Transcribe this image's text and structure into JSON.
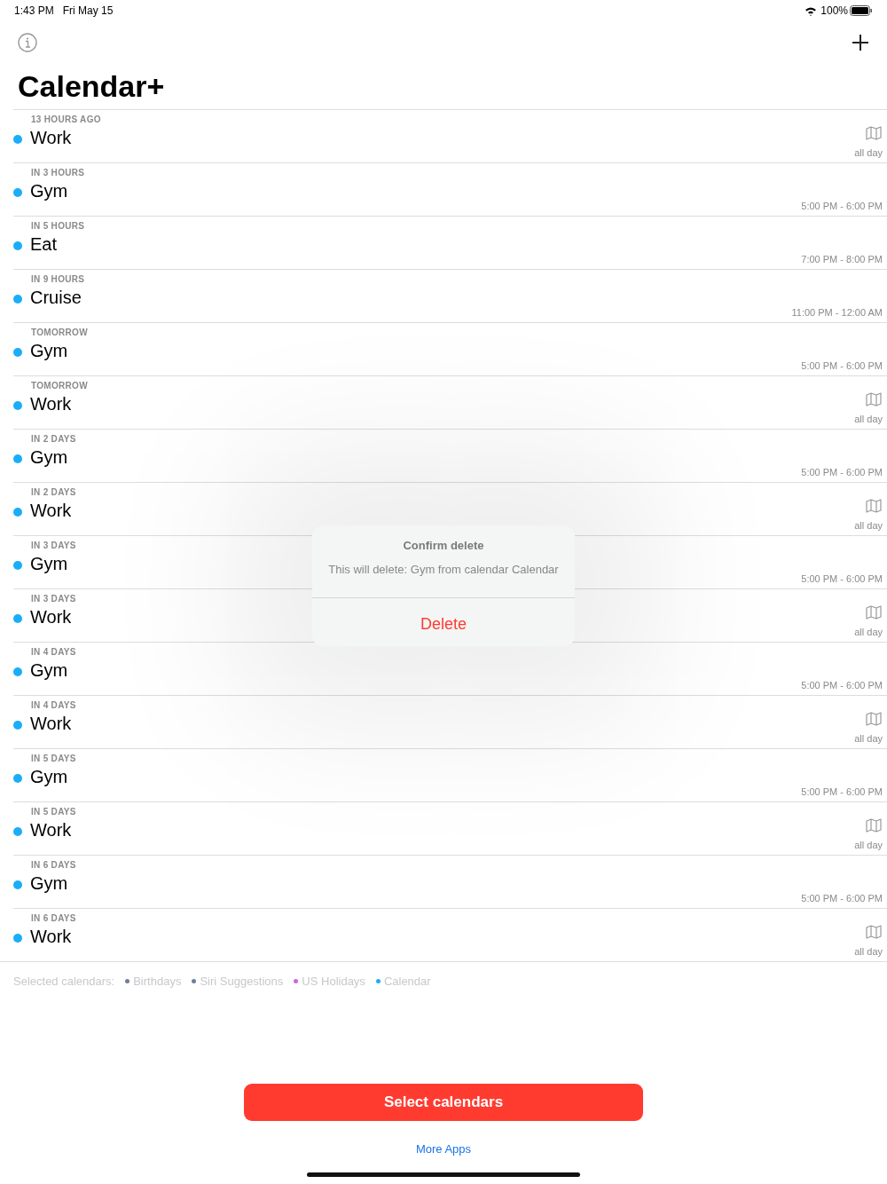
{
  "status_bar": {
    "time": "1:43 PM",
    "date": "Fri May 15",
    "battery": "100%"
  },
  "title": "Calendar+",
  "events": [
    {
      "when": "13 HOURS AGO",
      "title": "Work",
      "kind": "all_day",
      "time": "all day",
      "color": "#1badf8"
    },
    {
      "when": "IN 3 HOURS",
      "title": "Gym",
      "kind": "timed",
      "time": "5:00 PM - 6:00 PM",
      "color": "#1badf8"
    },
    {
      "when": "IN 5 HOURS",
      "title": "Eat",
      "kind": "timed",
      "time": "7:00 PM - 8:00 PM",
      "color": "#1badf8"
    },
    {
      "when": "IN 9 HOURS",
      "title": "Cruise",
      "kind": "timed",
      "time": "11:00 PM - 12:00 AM",
      "color": "#1badf8"
    },
    {
      "when": "TOMORROW",
      "title": "Gym",
      "kind": "timed",
      "time": "5:00 PM - 6:00 PM",
      "color": "#1badf8"
    },
    {
      "when": "TOMORROW",
      "title": "Work",
      "kind": "all_day",
      "time": "all day",
      "color": "#1badf8"
    },
    {
      "when": "IN 2 DAYS",
      "title": "Gym",
      "kind": "timed",
      "time": "5:00 PM - 6:00 PM",
      "color": "#1badf8"
    },
    {
      "when": "IN 2 DAYS",
      "title": "Work",
      "kind": "all_day",
      "time": "all day",
      "color": "#1badf8"
    },
    {
      "when": "IN 3 DAYS",
      "title": "Gym",
      "kind": "timed",
      "time": "5:00 PM - 6:00 PM",
      "color": "#1badf8"
    },
    {
      "when": "IN 3 DAYS",
      "title": "Work",
      "kind": "all_day",
      "time": "all day",
      "color": "#1badf8"
    },
    {
      "when": "IN 4 DAYS",
      "title": "Gym",
      "kind": "timed",
      "time": "5:00 PM - 6:00 PM",
      "color": "#1badf8"
    },
    {
      "when": "IN 4 DAYS",
      "title": "Work",
      "kind": "all_day",
      "time": "all day",
      "color": "#1badf8"
    },
    {
      "when": "IN 5 DAYS",
      "title": "Gym",
      "kind": "timed",
      "time": "5:00 PM - 6:00 PM",
      "color": "#1badf8"
    },
    {
      "when": "IN 5 DAYS",
      "title": "Work",
      "kind": "all_day",
      "time": "all day",
      "color": "#1badf8"
    },
    {
      "when": "IN 6 DAYS",
      "title": "Gym",
      "kind": "timed",
      "time": "5:00 PM - 6:00 PM",
      "color": "#1badf8"
    },
    {
      "when": "IN 6 DAYS",
      "title": "Work",
      "kind": "all_day",
      "time": "all day",
      "color": "#1badf8"
    }
  ],
  "selected_calendars": {
    "label": "Selected calendars:",
    "calendars": [
      {
        "name": "Birthdays",
        "color": "#6e7f9e"
      },
      {
        "name": "Siri Suggestions",
        "color": "#6e7f9e"
      },
      {
        "name": "US Holidays",
        "color": "#cc66dd"
      },
      {
        "name": "Calendar",
        "color": "#1badf8"
      }
    ]
  },
  "select_button": "Select calendars",
  "more_apps": "More Apps",
  "dialog": {
    "title": "Confirm delete",
    "message": "This will delete: Gym from calendar Calendar",
    "action": "Delete"
  }
}
